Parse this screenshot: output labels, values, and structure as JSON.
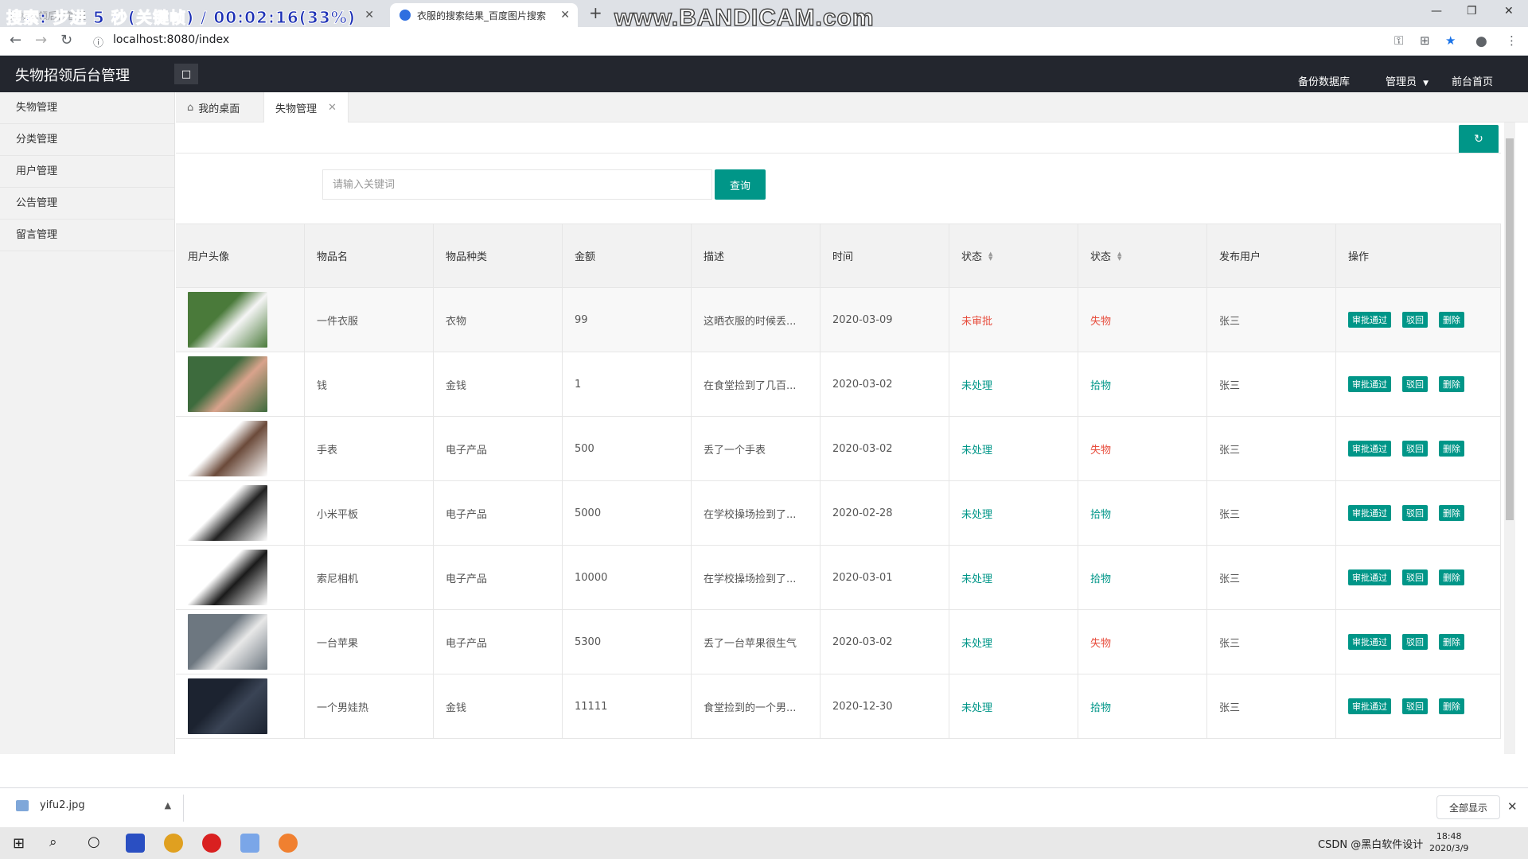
{
  "browser": {
    "tabs": [
      {
        "label": "失物招领后台管理"
      },
      {
        "label": "衣服的搜索结果_百度图片搜索"
      }
    ],
    "overlay_text": "搜索: 步进 5 秒(关键帧) / 00:02:16(33%)",
    "watermark": "www.BANDICAM.com",
    "url": "localhost:8080/index",
    "new_tab": "+"
  },
  "header": {
    "title": "失物招领后台管理",
    "toggle_icon": "□",
    "links": [
      "备份数据库",
      "管理员",
      "前台首页"
    ]
  },
  "sidebar": {
    "items": [
      {
        "label": "失物管理"
      },
      {
        "label": "分类管理"
      },
      {
        "label": "用户管理"
      },
      {
        "label": "公告管理"
      },
      {
        "label": "留言管理"
      }
    ]
  },
  "page_tabs": [
    {
      "label": "我的桌面",
      "icon": "home-icon"
    },
    {
      "label": "失物管理",
      "closable": true
    }
  ],
  "search": {
    "placeholder": "请输入关键词",
    "button": "查询",
    "refresh_icon": "↻"
  },
  "table": {
    "columns": [
      "用户头像",
      "物品名",
      "物品种类",
      "金额",
      "描述",
      "时间",
      "状态",
      "状态",
      "发布用户",
      "操作"
    ],
    "action_labels": {
      "approve": "审批通过",
      "reject": "驳回",
      "delete": "删除"
    },
    "rows": [
      {
        "name": "一件衣服",
        "category": "衣物",
        "amount": "99",
        "desc": "这晒衣服的时候丢...",
        "time": "2020-03-09",
        "status1": "未审批",
        "status2": "失物",
        "user": "张三",
        "thumb": [
          "#4a7a3a",
          "#f5f5f5"
        ]
      },
      {
        "name": "钱",
        "category": "金钱",
        "amount": "1",
        "desc": "在食堂捡到了几百...",
        "time": "2020-03-02",
        "status1": "未处理",
        "status2": "拾物",
        "user": "张三",
        "thumb": [
          "#3d6b3d",
          "#d9a38c"
        ]
      },
      {
        "name": "手表",
        "category": "电子产品",
        "amount": "500",
        "desc": "丢了一个手表",
        "time": "2020-03-02",
        "status1": "未处理",
        "status2": "失物",
        "user": "张三",
        "thumb": [
          "#ffffff",
          "#6b4a3a"
        ]
      },
      {
        "name": "小米平板",
        "category": "电子产品",
        "amount": "5000",
        "desc": "在学校操场捡到了...",
        "time": "2020-02-28",
        "status1": "未处理",
        "status2": "拾物",
        "user": "张三",
        "thumb": [
          "#ffffff",
          "#222222"
        ]
      },
      {
        "name": "索尼相机",
        "category": "电子产品",
        "amount": "10000",
        "desc": "在学校操场捡到了...",
        "time": "2020-03-01",
        "status1": "未处理",
        "status2": "拾物",
        "user": "张三",
        "thumb": [
          "#ffffff",
          "#1a1a1a"
        ]
      },
      {
        "name": "一台苹果",
        "category": "电子产品",
        "amount": "5300",
        "desc": "丢了一台苹果很生气",
        "time": "2020-03-02",
        "status1": "未处理",
        "status2": "失物",
        "user": "张三",
        "thumb": [
          "#6d7780",
          "#e8e8e8"
        ]
      },
      {
        "name": "一个男娃热",
        "category": "金钱",
        "amount": "11111",
        "desc": "食堂捡到的一个男...",
        "time": "2020-12-30",
        "status1": "未处理",
        "status2": "拾物",
        "user": "张三",
        "thumb": [
          "#1c2330",
          "#3a4455"
        ]
      }
    ]
  },
  "download": {
    "file": "yifu2.jpg",
    "show_all": "全部显示"
  },
  "taskbar": {
    "time": "18:48",
    "date": "2020/3/9",
    "tray_text": "CSDN @黑白软件设计"
  }
}
